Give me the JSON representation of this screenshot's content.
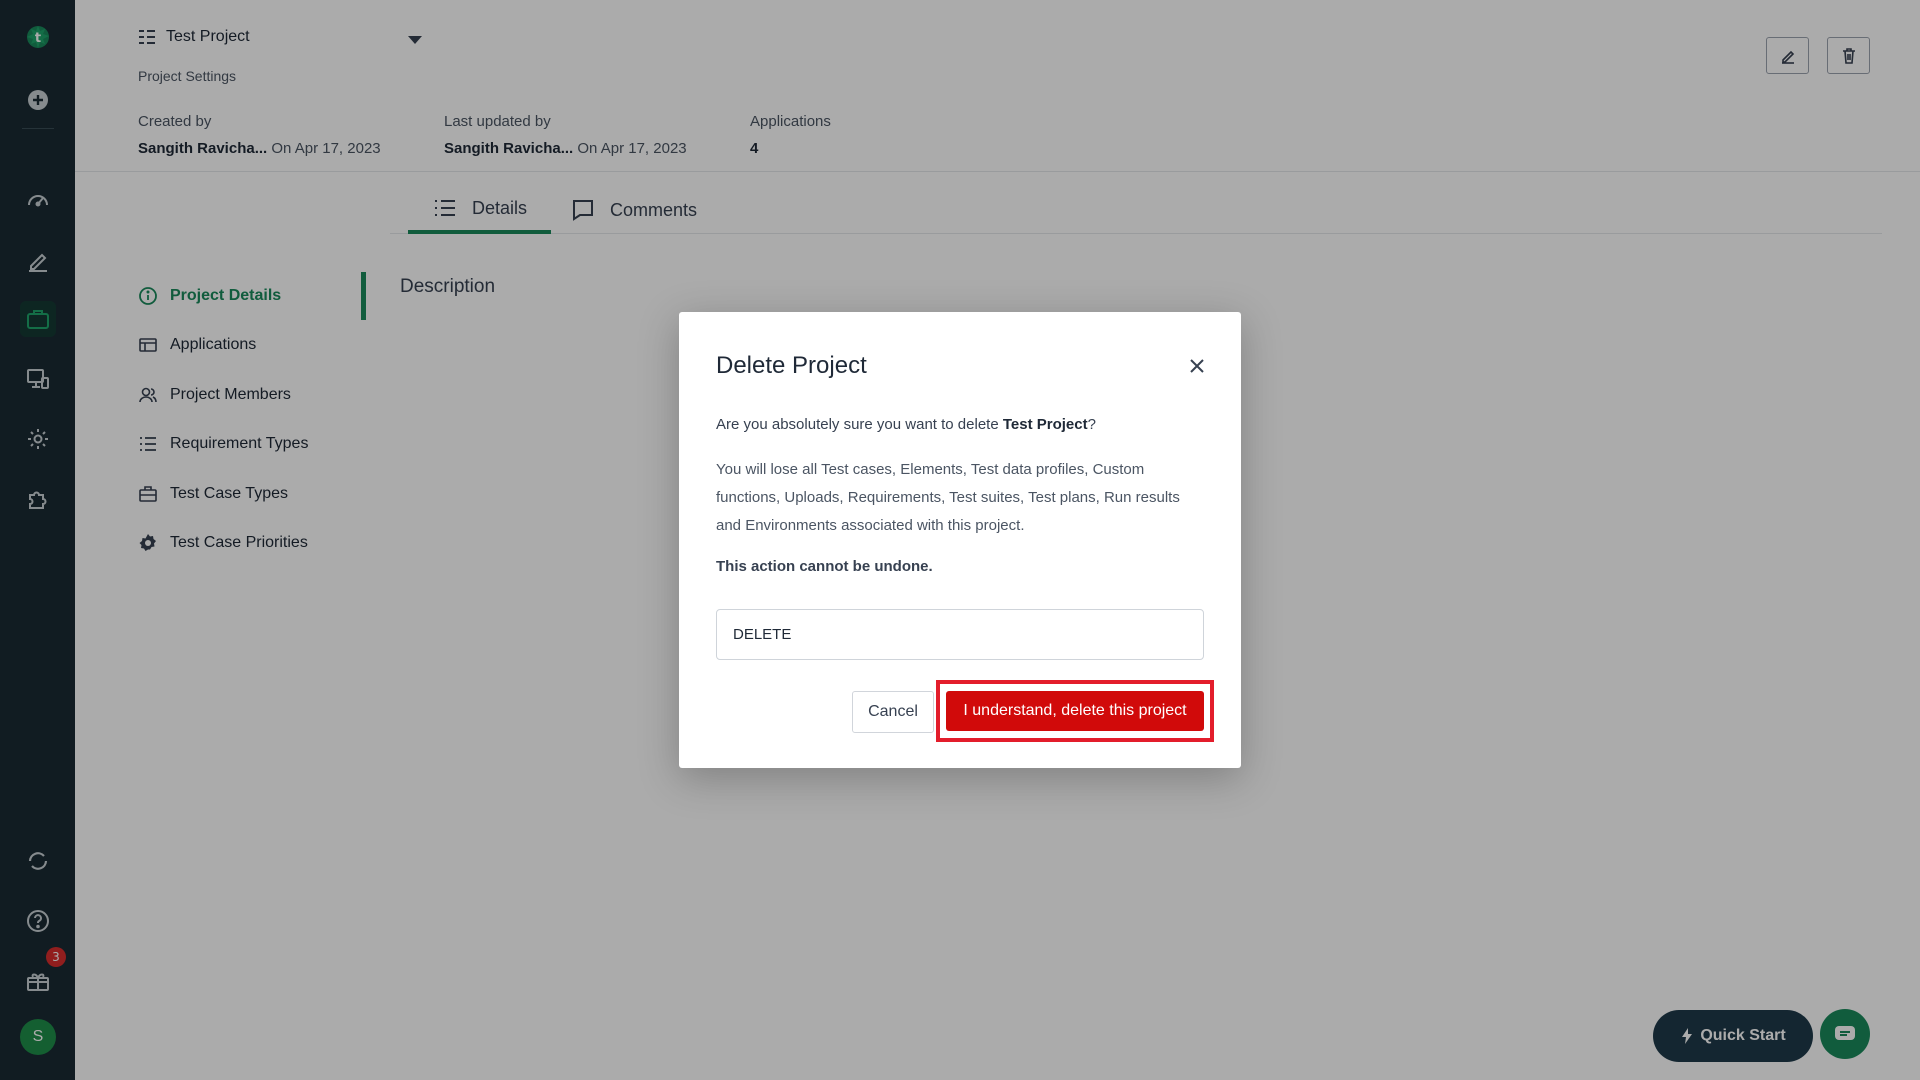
{
  "rail": {
    "icons": [
      "logo-icon",
      "add-icon",
      "dashboard-icon",
      "edit-icon",
      "briefcase-icon",
      "monitor-icon",
      "gear-icon",
      "puzzle-icon",
      "sync-icon",
      "help-icon",
      "gift-icon"
    ],
    "notification_count": "3",
    "avatar_initial": "S"
  },
  "header": {
    "project_name": "Test Project",
    "subtitle": "Project Settings",
    "created_by_label": "Created by",
    "created_by_name": "Sangith Ravicha...",
    "created_on": "On Apr 17, 2023",
    "updated_by_label": "Last updated by",
    "updated_by_name": "Sangith Ravicha...",
    "updated_on": "On Apr 17, 2023",
    "applications_label": "Applications",
    "applications_count": "4"
  },
  "leftnav": {
    "items": [
      {
        "label": "Project Details",
        "icon": "info-icon",
        "active": true
      },
      {
        "label": "Applications",
        "icon": "application-icon"
      },
      {
        "label": "Project Members",
        "icon": "users-icon"
      },
      {
        "label": "Requirement Types",
        "icon": "list-icon"
      },
      {
        "label": "Test Case Types",
        "icon": "briefcase-icon"
      },
      {
        "label": "Test Case Priorities",
        "icon": "gear-icon"
      }
    ]
  },
  "main": {
    "tabs": [
      {
        "label": "Details",
        "icon": "list-icon",
        "active": true
      },
      {
        "label": "Comments",
        "icon": "comment-icon"
      }
    ],
    "description_label": "Description"
  },
  "floating": {
    "quick_start": "Quick Start"
  },
  "modal": {
    "title": "Delete Project",
    "question_prefix": "Are you absolutely sure you want to delete ",
    "question_project": "Test Project",
    "question_suffix": "?",
    "warning": "You will lose all Test cases, Elements, Test data profiles, Custom functions, Uploads, Requirements, Test suites, Test plans, Run results and Environments associated with this project.",
    "undone": "This action cannot be undone.",
    "input_value": "DELETE",
    "cancel_label": "Cancel",
    "delete_label": "I understand, delete this project"
  },
  "colors": {
    "accent": "#1a8a5c",
    "danger": "#d10a0a",
    "rail": "#1a2b33"
  }
}
